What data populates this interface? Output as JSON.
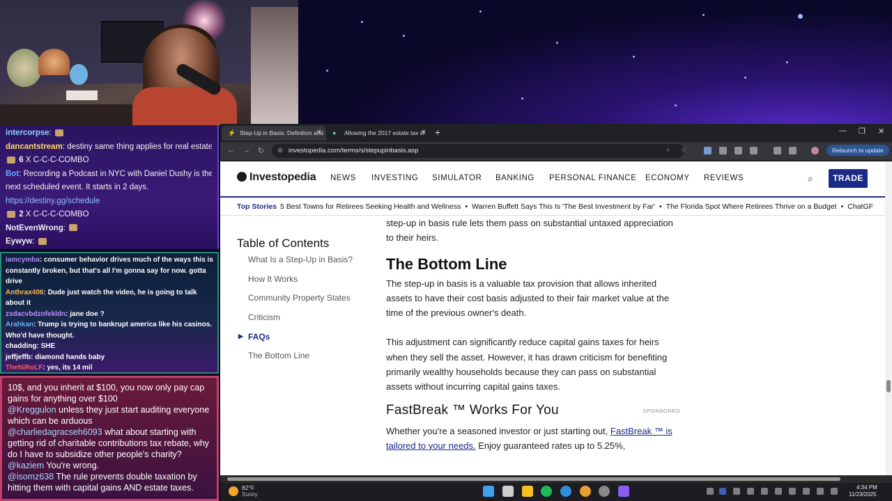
{
  "browser": {
    "tabs": [
      {
        "label": "Step-Up in Basis: Definition and"
      },
      {
        "label": "Allowing the 2017 estate tax cl"
      }
    ],
    "url": "investopedia.com/terms/s/stepupinbasis.asp",
    "relaunch_label": "Relaunch to update"
  },
  "site": {
    "logo": "Investopedia",
    "nav": [
      "NEWS",
      "INVESTING",
      "SIMULATOR",
      "BANKING",
      "PERSONAL FINANCE",
      "ECONOMY",
      "REVIEWS"
    ],
    "trade_label": "TRADE",
    "top_stories_label": "Top Stories",
    "top_stories": [
      "5 Best Towns for Retirees Seeking Health and Wellness",
      "Warren Buffett Says This Is 'The Best Investment by Far'",
      "The Florida Spot Where Retirees Thrive on a Budget",
      "ChatGF"
    ]
  },
  "toc": {
    "title": "Table of Contents",
    "items": [
      "What Is a Step-Up in Basis?",
      "How It Works",
      "Community Property States",
      "Criticism",
      "FAQs",
      "The Bottom Line"
    ]
  },
  "article": {
    "intro": "step-up in basis rule lets them pass on substantial untaxed appreciation to their heirs.",
    "bottom_line_title": "The Bottom Line",
    "p1": "The step-up in basis is a valuable tax provision that allows inherited assets to have their cost basis adjusted to their fair market value at the time of the previous owner's death.",
    "p2": "This adjustment can significantly reduce capital gains taxes for heirs when they sell the asset. However, it has drawn criticism for benefiting primarily wealthy households because they can pass on substantial assets without incurring capital gains taxes.",
    "fastbreak_title": "FastBreak ™  Works For You",
    "sponsored": "SPONSORED",
    "fb_text_before": "Whether you're a seasoned investor or just starting out, ",
    "fb_link": "FastBreak ™ is tailored to your needs.",
    "fb_text_after": " Enjoy guaranteed rates up to 5.25%,"
  },
  "chat_top": [
    {
      "user": "intercorpse",
      "color": "#8fd1ff",
      "msg": ""
    },
    {
      "user": "dancantstream",
      "color": "#ffd76a",
      "msg": "destiny same thing applies for real estate"
    },
    {
      "combo": "6",
      "text": "C-C-C-COMBO"
    },
    {
      "user": "Bot",
      "color": "#6aa8ff",
      "msg": "Recording a Podcast in NYC with Daniel Dushy is the"
    },
    {
      "user": "",
      "color": "#fff",
      "msg": "next scheduled event. It starts in 2 days."
    },
    {
      "user": "",
      "color": "#fff",
      "msg": "https://destiny.gg/schedule",
      "link": true
    },
    {
      "combo": "2",
      "text": "C-C-C-COMBO"
    },
    {
      "user": "NotEvenWrong",
      "color": "#ffffff",
      "msg": ""
    },
    {
      "user": "Eywyw",
      "color": "#ffffff",
      "msg": ""
    }
  ],
  "chat_mid": [
    {
      "user": "iamcymba",
      "color": "#b58cff",
      "msg": "consumer behavior drives much of the ways this is constantly broken, but that's all I'm gonna say for now. gotta drive"
    },
    {
      "user": "Anthrax406",
      "color": "#ffb84d",
      "msg": "Dude just watch the video, he is going to talk about it"
    },
    {
      "user": "zsdacvbdznfekldn",
      "color": "#c08cff",
      "msg": "jane doe ?"
    },
    {
      "user": "Arahkan",
      "color": "#6ab0ff",
      "msg": "Trump is trying to bankrupt america like his casinos. Who'd have thought."
    },
    {
      "user": "chadding",
      "color": "#ffffff",
      "msg": "SHE"
    },
    {
      "user": "jeffjeffb",
      "color": "#ffffff",
      "msg": "diamond hands baby"
    },
    {
      "user": "TheNiRoLF",
      "color": "#ff5a5a",
      "msg": "yes, its 14 mil"
    }
  ],
  "chat_bot": [
    {
      "user": "",
      "msg": "10$, and you inherit at $100, you now only pay cap gains for anything over $100"
    },
    {
      "user": "@Kreggulon",
      "msg": "unless they just start auditing everyone which can be arduous"
    },
    {
      "user": "@charliedagracseh6093",
      "msg": "what about starting with getting rid of charitable contributions tax rebate, why do I have to subsidize other people's charity?"
    },
    {
      "user": "@kaziem",
      "msg": "You're wrong."
    },
    {
      "user": "@isomz638",
      "msg": "The rule prevents double taxation by hitting them with capital gains AND estate taxes."
    }
  ],
  "taskbar": {
    "temp": "82°F",
    "weather": "Sunny",
    "time": "4:34 PM",
    "date": "11/23/2025"
  }
}
